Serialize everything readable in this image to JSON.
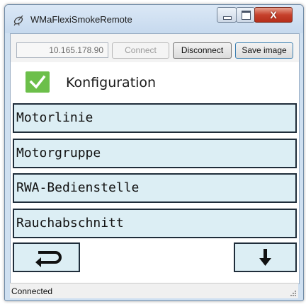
{
  "window": {
    "title": "WMaFlexiSmokeRemote",
    "app_icon": "satellite-dish-icon",
    "controls": {
      "minimize_icon": "minimize-icon",
      "maximize_icon": "maximize-icon",
      "close_icon": "close-icon",
      "close_label": "X"
    }
  },
  "toolbar": {
    "ip_address": "10.165.178.90",
    "connect_label": "Connect",
    "connect_enabled": false,
    "disconnect_label": "Disconnect",
    "save_label": "Save image"
  },
  "config": {
    "checked": true,
    "label": "Konfiguration"
  },
  "menu": {
    "items": [
      {
        "label": "Motorlinie"
      },
      {
        "label": "Motorgruppe"
      },
      {
        "label": "RWA-Bedienstelle"
      },
      {
        "label": "Rauchabschnitt"
      }
    ]
  },
  "nav": {
    "back_icon": "return-arrow-icon",
    "down_icon": "arrow-down-icon"
  },
  "status": {
    "text": "Connected"
  },
  "colors": {
    "menu_background": "#dceef4",
    "check_green": "#6cbf4a",
    "close_red": "#c6412c"
  }
}
